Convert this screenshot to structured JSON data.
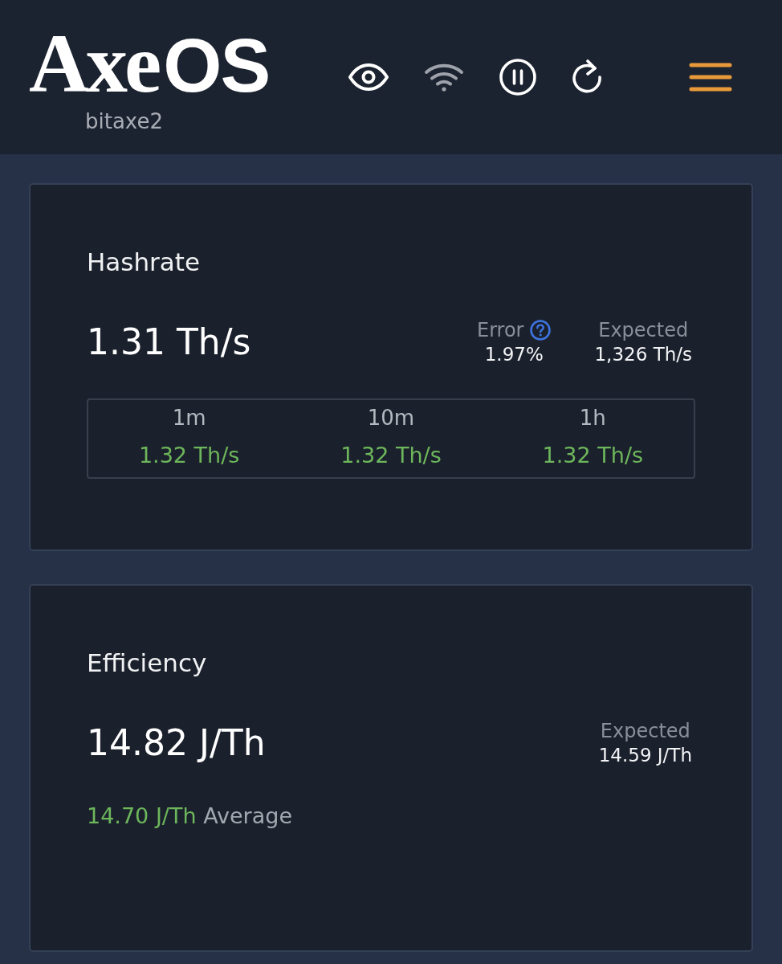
{
  "header": {
    "logo": {
      "script": "Axe",
      "block": "OS"
    },
    "hostname": "bitaxe2"
  },
  "cards": [
    {
      "kind": "hashrate",
      "title": "Hashrate",
      "value": "1.31 Th/s",
      "error": {
        "label": "Error",
        "value": "1.97%"
      },
      "expected": {
        "label": "Expected",
        "value": "1,326 Th/s"
      },
      "averages": [
        {
          "label": "1m",
          "value": "1.32 Th/s"
        },
        {
          "label": "10m",
          "value": "1.32 Th/s"
        },
        {
          "label": "1h",
          "value": "1.32 Th/s"
        }
      ]
    },
    {
      "kind": "efficiency",
      "title": "Efficiency",
      "value": "14.82 J/Th",
      "expected": {
        "label": "Expected",
        "value": "14.59 J/Th"
      },
      "average": {
        "value": "14.70 J/Th",
        "label": "Average"
      }
    }
  ]
}
